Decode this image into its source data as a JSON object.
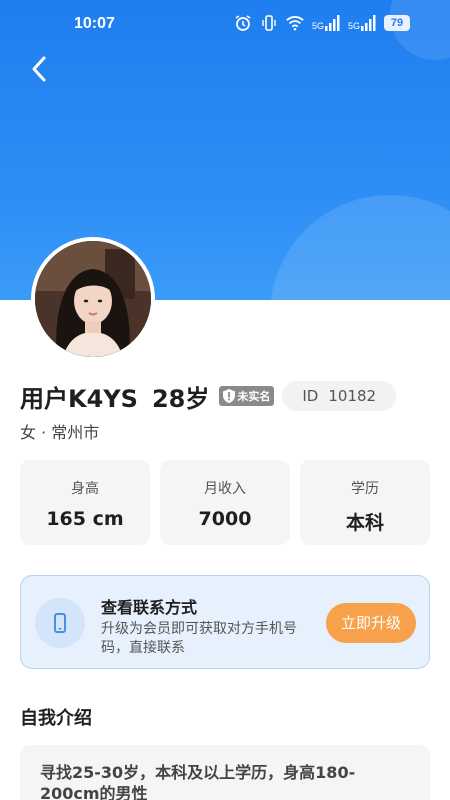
{
  "status_bar": {
    "time": "10:07",
    "battery": "79",
    "signal_label": "5G"
  },
  "profile": {
    "name": "用户K4YS",
    "age": "28岁",
    "verify_label": "未实名",
    "id_label": "ID",
    "id_value": "10182",
    "gender_city": "女 · 常州市"
  },
  "stats": [
    {
      "label": "身高",
      "value": "165 cm"
    },
    {
      "label": "月收入",
      "value": "7000"
    },
    {
      "label": "学历",
      "value": "本科"
    }
  ],
  "contact": {
    "title": "查看联系方式",
    "description": "升级为会员即可获取对方手机号码，直接联系",
    "button": "立即升级"
  },
  "intro": {
    "title": "自我介绍",
    "text": "寻找25-30岁，本科及以上学历，身高180-200cm的男性"
  },
  "colors": {
    "hero": "#1f7ef0",
    "accent": "#f7a24a",
    "card_bg": "#e7f0fd"
  }
}
